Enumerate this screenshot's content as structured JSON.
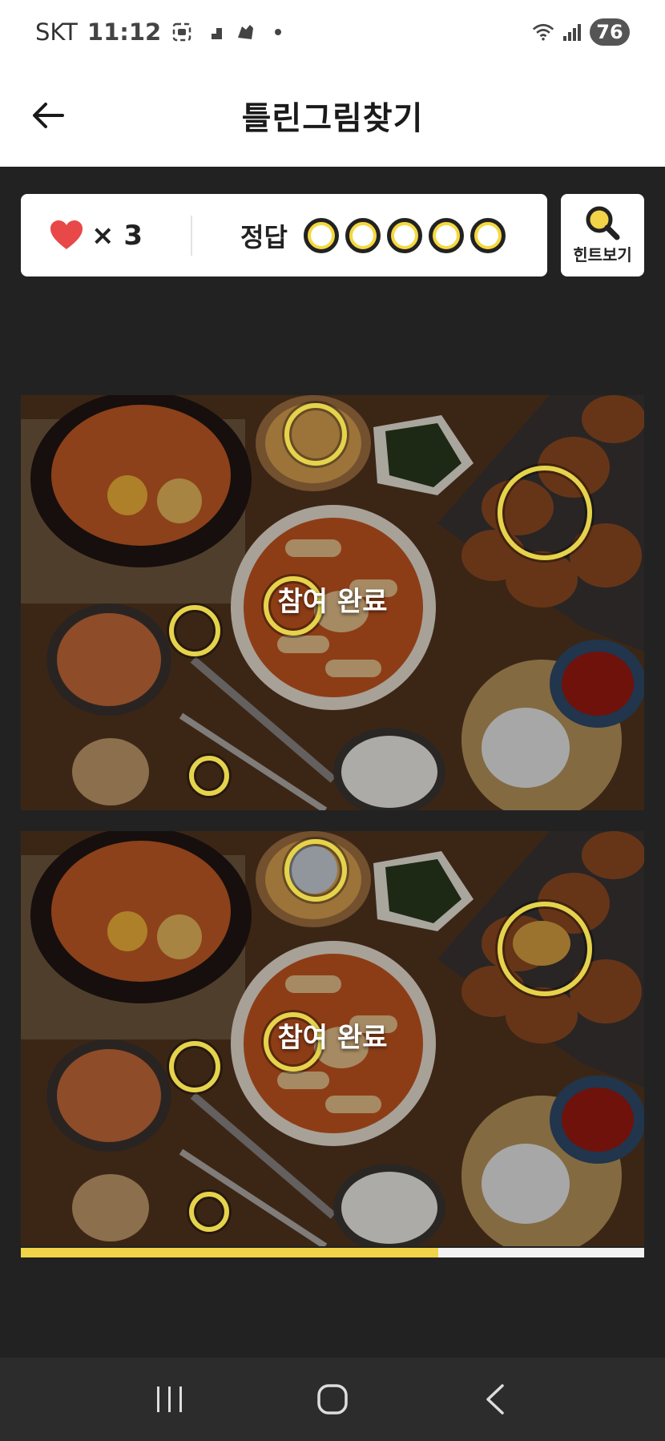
{
  "status_bar": {
    "carrier": "SKT",
    "time": "11:12",
    "battery": "76"
  },
  "header": {
    "title": "틀린그림찾기"
  },
  "lives": {
    "count_text": "× 3"
  },
  "answers": {
    "label": "정답",
    "slots": 5
  },
  "hint": {
    "label": "힌트보기"
  },
  "puzzles": {
    "top_overlay_text": "참여 완료",
    "bottom_overlay_text": "참여 완료"
  },
  "progress": {
    "fraction": 0.67
  },
  "colors": {
    "accent": "#f1d448",
    "background": "#222222",
    "heart": "#e84848"
  }
}
